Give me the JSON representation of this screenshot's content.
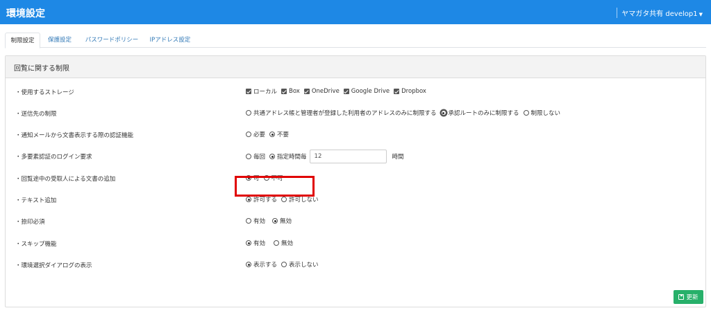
{
  "header": {
    "title": "環境設定",
    "user": "ヤマガタ共有 develop1",
    "caret": "▼"
  },
  "tabs": [
    {
      "label": "制限設定",
      "active": true
    },
    {
      "label": "保護設定",
      "active": false
    },
    {
      "label": "パスワードポリシー",
      "active": false
    },
    {
      "label": "IPアドレス設定",
      "active": false
    }
  ],
  "card": {
    "title": "回覧に関する制限"
  },
  "settings": {
    "storage": {
      "label": "・使用するストレージ",
      "options": [
        "ローカル",
        "Box",
        "OneDrive",
        "Google Drive",
        "Dropbox"
      ]
    },
    "recipient": {
      "label": "・送信先の制限",
      "options": [
        "共通アドレス帳と管理者が登録した利用者のアドレスのみに制限する",
        "承認ルートのみに制限する",
        "制限しない"
      ],
      "selected": 1
    },
    "mail_auth": {
      "label": "・通知メールから文書表示する際の認証機能",
      "options": [
        "必要",
        "不要"
      ],
      "selected": 1
    },
    "mfa": {
      "label": "・多要素認証のログイン要求",
      "options": [
        "毎回",
        "指定時間毎"
      ],
      "selected": 1,
      "value": "12",
      "unit": "時間"
    },
    "add_doc": {
      "label": "・回覧途中の受取人による文書の追加",
      "options": [
        "可",
        "不可"
      ],
      "selected": 0
    },
    "text_add": {
      "label": "・テキスト追加",
      "options": [
        "許可する",
        "許可しない"
      ],
      "selected": 0
    },
    "stamp_required": {
      "label": "・捺印必須",
      "options": [
        "有効",
        "無効"
      ],
      "selected": 1
    },
    "skip": {
      "label": "・スキップ機能",
      "options": [
        "有効",
        "無効"
      ],
      "selected": 0
    },
    "env_dialog": {
      "label": "・環境選択ダイアログの表示",
      "options": [
        "表示する",
        "表示しない"
      ],
      "selected": 0
    }
  },
  "buttons": {
    "update": "更新"
  },
  "colors": {
    "header": "#1e88e5",
    "update_button": "#27b06a",
    "highlight": "#e00000"
  }
}
